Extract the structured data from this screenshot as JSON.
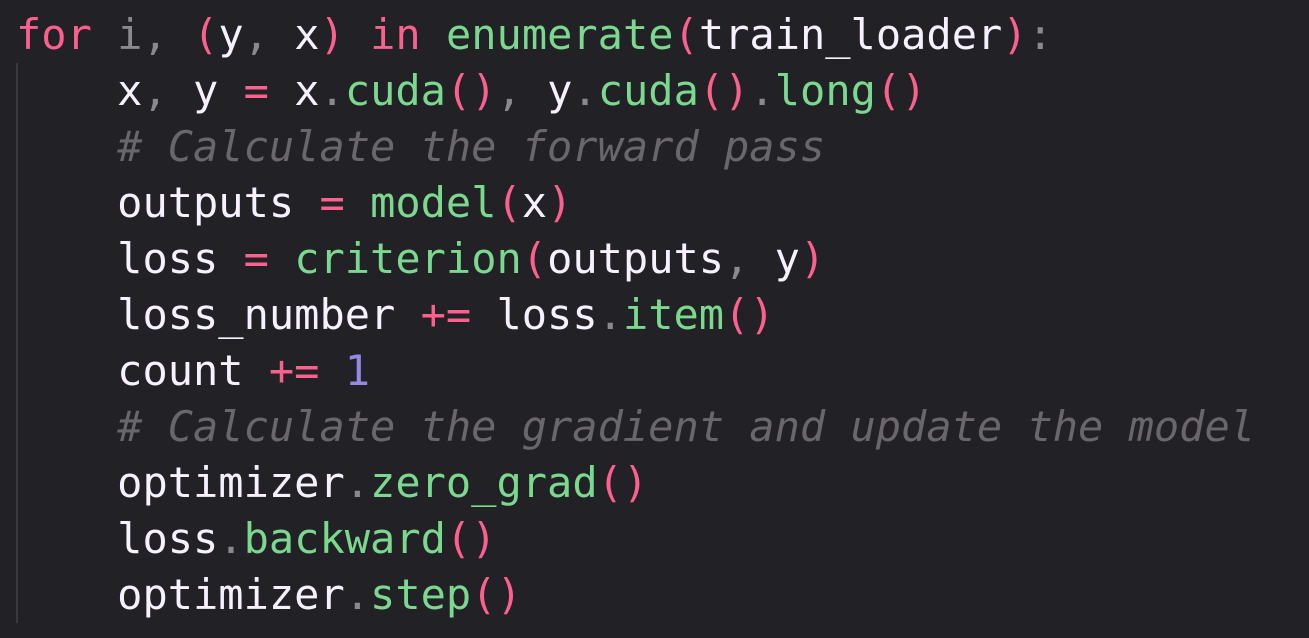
{
  "editor": {
    "lines": [
      {
        "tokens": [
          {
            "t": "for",
            "k": "kw"
          },
          {
            "t": " ",
            "k": "var"
          },
          {
            "t": "i",
            "k": "punc"
          },
          {
            "t": ", ",
            "k": "punc"
          },
          {
            "t": "(",
            "k": "paren"
          },
          {
            "t": "y",
            "k": "var"
          },
          {
            "t": ", ",
            "k": "punc"
          },
          {
            "t": "x",
            "k": "var"
          },
          {
            "t": ")",
            "k": "paren"
          },
          {
            "t": " ",
            "k": "var"
          },
          {
            "t": "in",
            "k": "kw"
          },
          {
            "t": " ",
            "k": "var"
          },
          {
            "t": "enumerate",
            "k": "fn"
          },
          {
            "t": "(",
            "k": "paren"
          },
          {
            "t": "train_loader",
            "k": "var"
          },
          {
            "t": ")",
            "k": "paren"
          },
          {
            "t": ":",
            "k": "punc"
          }
        ]
      },
      {
        "tokens": [
          {
            "t": "    ",
            "k": "var"
          },
          {
            "t": "x",
            "k": "var"
          },
          {
            "t": ", ",
            "k": "punc"
          },
          {
            "t": "y",
            "k": "var"
          },
          {
            "t": " ",
            "k": "var"
          },
          {
            "t": "=",
            "k": "op"
          },
          {
            "t": " ",
            "k": "var"
          },
          {
            "t": "x",
            "k": "var"
          },
          {
            "t": ".",
            "k": "punc"
          },
          {
            "t": "cuda",
            "k": "fn"
          },
          {
            "t": "()",
            "k": "paren"
          },
          {
            "t": ", ",
            "k": "punc"
          },
          {
            "t": "y",
            "k": "var"
          },
          {
            "t": ".",
            "k": "punc"
          },
          {
            "t": "cuda",
            "k": "fn"
          },
          {
            "t": "()",
            "k": "paren"
          },
          {
            "t": ".",
            "k": "punc"
          },
          {
            "t": "long",
            "k": "fn"
          },
          {
            "t": "()",
            "k": "paren"
          }
        ]
      },
      {
        "tokens": [
          {
            "t": "    ",
            "k": "var"
          },
          {
            "t": "# Calculate the forward pass",
            "k": "cmt"
          }
        ]
      },
      {
        "tokens": [
          {
            "t": "    ",
            "k": "var"
          },
          {
            "t": "outputs",
            "k": "var"
          },
          {
            "t": " ",
            "k": "var"
          },
          {
            "t": "=",
            "k": "op"
          },
          {
            "t": " ",
            "k": "var"
          },
          {
            "t": "model",
            "k": "fn"
          },
          {
            "t": "(",
            "k": "paren"
          },
          {
            "t": "x",
            "k": "var"
          },
          {
            "t": ")",
            "k": "paren"
          }
        ]
      },
      {
        "tokens": [
          {
            "t": "    ",
            "k": "var"
          },
          {
            "t": "loss",
            "k": "var"
          },
          {
            "t": " ",
            "k": "var"
          },
          {
            "t": "=",
            "k": "op"
          },
          {
            "t": " ",
            "k": "var"
          },
          {
            "t": "criterion",
            "k": "fn"
          },
          {
            "t": "(",
            "k": "paren"
          },
          {
            "t": "outputs",
            "k": "var"
          },
          {
            "t": ", ",
            "k": "punc"
          },
          {
            "t": "y",
            "k": "var"
          },
          {
            "t": ")",
            "k": "paren"
          }
        ]
      },
      {
        "tokens": [
          {
            "t": "    ",
            "k": "var"
          },
          {
            "t": "loss_number",
            "k": "var"
          },
          {
            "t": " ",
            "k": "var"
          },
          {
            "t": "+=",
            "k": "op"
          },
          {
            "t": " ",
            "k": "var"
          },
          {
            "t": "loss",
            "k": "var"
          },
          {
            "t": ".",
            "k": "punc"
          },
          {
            "t": "item",
            "k": "fn"
          },
          {
            "t": "()",
            "k": "paren"
          }
        ]
      },
      {
        "tokens": [
          {
            "t": "    ",
            "k": "var"
          },
          {
            "t": "count",
            "k": "var"
          },
          {
            "t": " ",
            "k": "var"
          },
          {
            "t": "+=",
            "k": "op"
          },
          {
            "t": " ",
            "k": "var"
          },
          {
            "t": "1",
            "k": "num"
          }
        ]
      },
      {
        "tokens": [
          {
            "t": "    ",
            "k": "var"
          },
          {
            "t": "# Calculate the gradient and update the model",
            "k": "cmt"
          }
        ]
      },
      {
        "tokens": [
          {
            "t": "    ",
            "k": "var"
          },
          {
            "t": "optimizer",
            "k": "var"
          },
          {
            "t": ".",
            "k": "punc"
          },
          {
            "t": "zero_grad",
            "k": "fn"
          },
          {
            "t": "()",
            "k": "paren"
          }
        ]
      },
      {
        "tokens": [
          {
            "t": "    ",
            "k": "var"
          },
          {
            "t": "loss",
            "k": "var"
          },
          {
            "t": ".",
            "k": "punc"
          },
          {
            "t": "backward",
            "k": "fn"
          },
          {
            "t": "()",
            "k": "paren"
          }
        ]
      },
      {
        "tokens": [
          {
            "t": "    ",
            "k": "var"
          },
          {
            "t": "optimizer",
            "k": "var"
          },
          {
            "t": ".",
            "k": "punc"
          },
          {
            "t": "step",
            "k": "fn"
          },
          {
            "t": "()",
            "k": "paren"
          }
        ]
      }
    ]
  },
  "theme": {
    "background": "#222126",
    "keyword": "#fc618d",
    "function": "#7bd88f",
    "punctuation": "#8b888f",
    "number": "#948ae3",
    "text": "#f7f1ff",
    "comment": "#69676c"
  }
}
